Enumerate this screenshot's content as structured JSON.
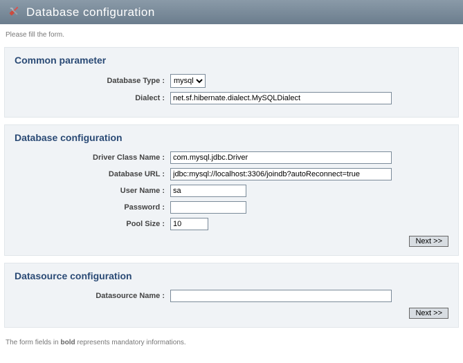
{
  "header": {
    "title": "Database configuration"
  },
  "intro": "Please fill the form.",
  "common": {
    "title": "Common parameter",
    "db_type_label": "Database Type :",
    "db_type_value": "mysql",
    "db_type_options": [
      "mysql"
    ],
    "dialect_label": "Dialect :",
    "dialect_value": "net.sf.hibernate.dialect.MySQLDialect"
  },
  "dbconf": {
    "title": "Database configuration",
    "driver_label": "Driver Class Name :",
    "driver_value": "com.mysql.jdbc.Driver",
    "url_label": "Database URL :",
    "url_value": "jdbc:mysql://localhost:3306/joindb?autoReconnect=true",
    "user_label": "User Name :",
    "user_value": "sa",
    "pass_label": "Password :",
    "pass_value": "",
    "pool_label": "Pool Size :",
    "pool_value": "10",
    "next_label": "Next >>"
  },
  "dsconf": {
    "title": "Datasource configuration",
    "ds_label": "Datasource Name :",
    "ds_value": "",
    "next_label": "Next >>"
  },
  "footer": {
    "prefix": "The form fields in ",
    "bold": "bold",
    "suffix": " represents mandatory informations."
  }
}
